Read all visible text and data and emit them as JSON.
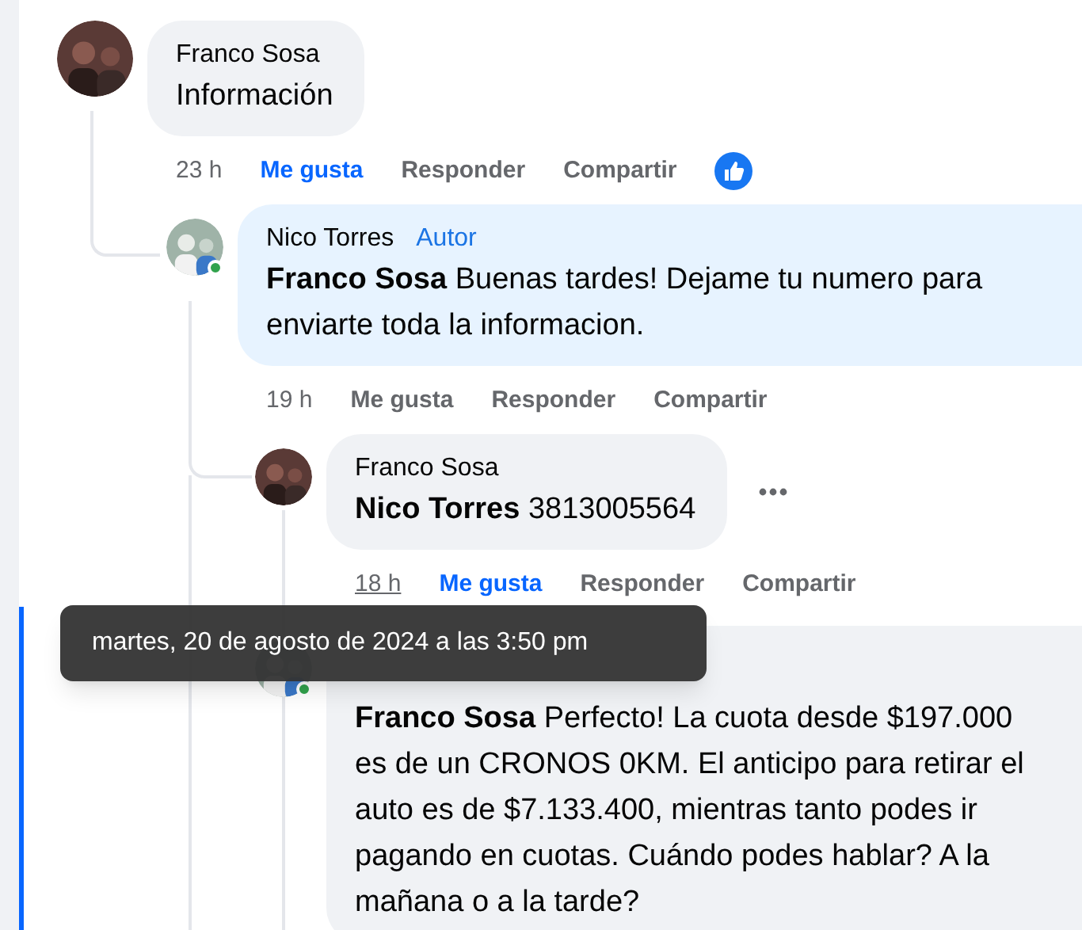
{
  "comments": [
    {
      "author": "Franco Sosa",
      "text": "Información",
      "time": "23 h",
      "time_hovered": false,
      "liked": true,
      "actions": [
        "Me gusta",
        "Responder",
        "Compartir"
      ],
      "reacted": true,
      "online": false,
      "more_menu": false,
      "replies": [
        {
          "author": "Nico Torres",
          "badge": "Autor",
          "text": "**Franco Sosa** Buenas tardes! Dejame tu numero para enviarte toda la informacion.",
          "time": "19 h",
          "time_hovered": false,
          "liked": false,
          "actions": [
            "Me gusta",
            "Responder",
            "Compartir"
          ],
          "online": true,
          "more_menu": false,
          "highlight": true,
          "replies": [
            {
              "author": "Franco Sosa",
              "text": "**Nico Torres** 3813005564",
              "time": "18 h",
              "time_hovered": true,
              "liked": true,
              "actions": [
                "Me gusta",
                "Responder",
                "Compartir"
              ],
              "online": false,
              "more_menu": true
            },
            {
              "text": "**Franco Sosa** Perfecto! La cuota desde $197.000 es de un CRONOS 0KM. El anticipo para retirar el auto es de $7.133.400, mientras tanto podes ir pagando en cuotas. Cuándo podes hablar? A la mañana o a la tarde?",
              "online": true,
              "more_menu": false
            }
          ]
        }
      ]
    }
  ],
  "tooltip": "martes, 20 de agosto de 2024 a las 3:50 pm"
}
